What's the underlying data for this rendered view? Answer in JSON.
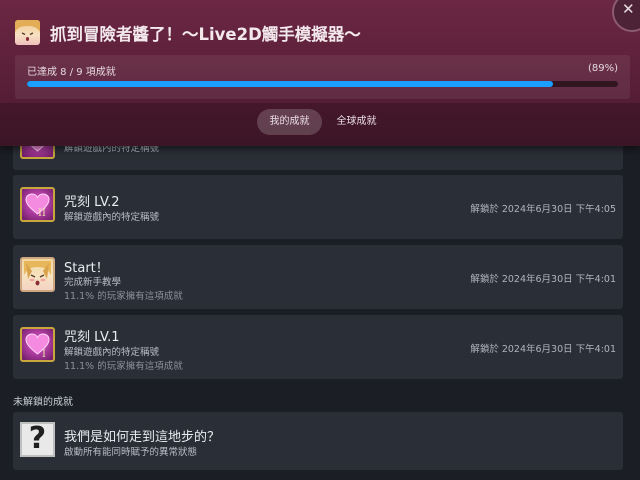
{
  "header": {
    "title": "抓到冒險者醬了！～Live2D觸手模擬器～",
    "progress_label": "已達成 8 / 9 項成就",
    "progress_percent_label": "(89%)",
    "progress_fraction": 0.89,
    "tabs": [
      {
        "label": "我的成就",
        "active": true
      },
      {
        "label": "全球成就",
        "active": false
      }
    ]
  },
  "achievements": [
    {
      "title": "",
      "desc": "解鎖遊戲內的特定稱號",
      "percent": "",
      "unlock": "",
      "icon": "heart-roman-iii-icon"
    },
    {
      "title": "咒刻 LV.2",
      "desc": "解鎖遊戲內的特定稱號",
      "percent": "",
      "unlock": "解鎖於 2024年6月30日 下午4:05",
      "icon": "heart-roman-ii-icon"
    },
    {
      "title": "Start！",
      "desc": "完成新手教學",
      "percent": "11.1% 的玩家擁有這項成就",
      "unlock": "解鎖於 2024年6月30日 下午4:01",
      "icon": "anime-girl-face-icon"
    },
    {
      "title": "咒刻 LV.1",
      "desc": "解鎖遊戲內的特定稱號",
      "percent": "11.1% 的玩家擁有這項成就",
      "unlock": "解鎖於 2024年6月30日 下午4:01",
      "icon": "heart-roman-i-icon"
    }
  ],
  "locked_section_label": "未解鎖的成就",
  "locked": [
    {
      "title": "我們是如何走到這地步的？",
      "desc": "啟動所有能同時賦予的異常狀態",
      "icon": "question-mark-icon"
    }
  ],
  "colors": {
    "header_bg": "#5a1f38",
    "progress_fill": "#1a9fff",
    "card_bg": "#2a2f37",
    "page_bg": "#1b1e25"
  }
}
